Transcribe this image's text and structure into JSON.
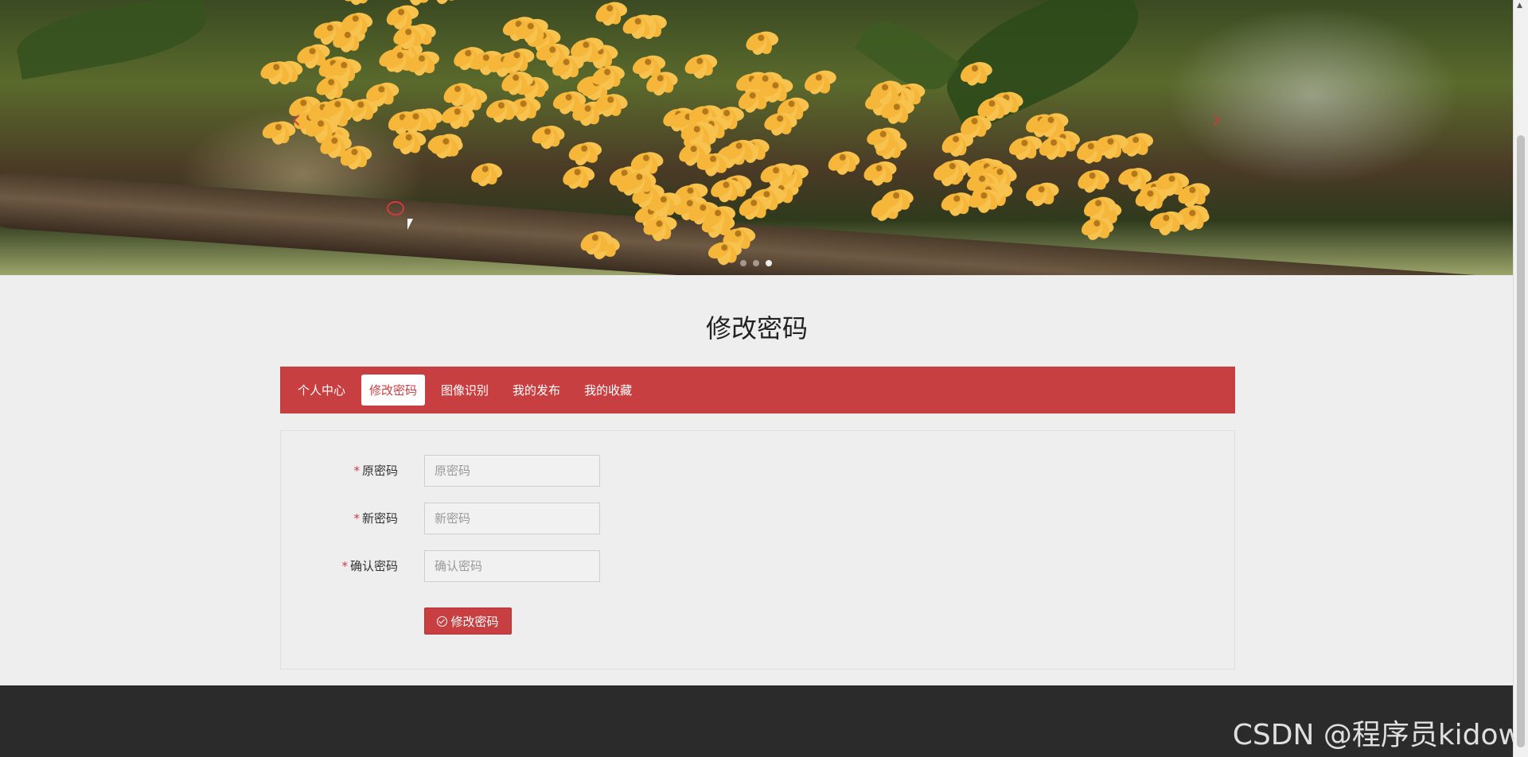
{
  "banner": {
    "prev_arrow": "‹",
    "next_arrow": "›",
    "dots": [
      false,
      false,
      true
    ]
  },
  "page": {
    "title": "修改密码"
  },
  "tabs": [
    {
      "label": "个人中心",
      "active": false
    },
    {
      "label": "修改密码",
      "active": true
    },
    {
      "label": "图像识别",
      "active": false
    },
    {
      "label": "我的发布",
      "active": false
    },
    {
      "label": "我的收藏",
      "active": false
    }
  ],
  "form": {
    "old_password": {
      "label": "原密码",
      "placeholder": "原密码",
      "required_mark": "*"
    },
    "new_password": {
      "label": "新密码",
      "placeholder": "新密码",
      "required_mark": "*"
    },
    "confirm_password": {
      "label": "确认密码",
      "placeholder": "确认密码",
      "required_mark": "*"
    },
    "submit_label": "修改密码"
  },
  "watermark": "CSDN @程序员kidow",
  "colors": {
    "accent": "#c73f41",
    "footer": "#2b2b2b",
    "background": "#efeeef"
  }
}
